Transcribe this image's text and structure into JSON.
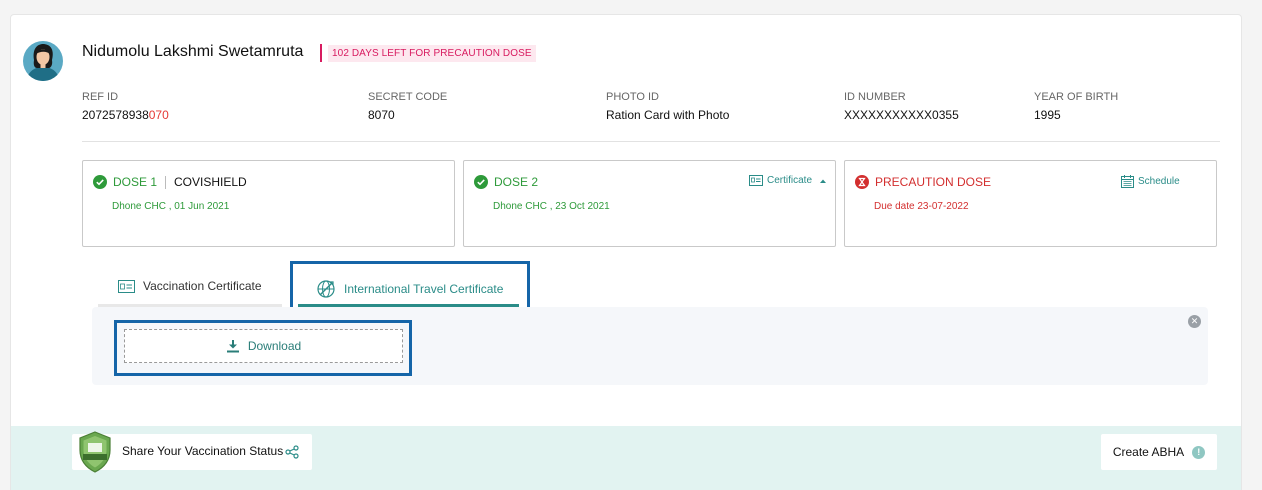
{
  "beneficiary": {
    "name": "Nidumolu Lakshmi Swetamruta",
    "days_left": "102 DAYS LEFT FOR PRECAUTION DOSE"
  },
  "info": {
    "ref_label": "REF ID",
    "ref_main": "2072578938",
    "ref_highlight": "070",
    "secret_label": "SECRET CODE",
    "secret_value": "8070",
    "photo_label": "PHOTO ID",
    "photo_value": "Ration Card with Photo",
    "idnum_label": "ID NUMBER",
    "idnum_value": "XXXXXXXXXXX0355",
    "yob_label": "YEAR OF BIRTH",
    "yob_value": "1995"
  },
  "doses": {
    "dose1": {
      "label": "DOSE 1",
      "vaccine": "COVISHIELD",
      "detail": "Dhone CHC , 01 Jun 2021"
    },
    "dose2": {
      "label": "DOSE 2",
      "detail": "Dhone CHC , 23 Oct 2021",
      "action": "Certificate"
    },
    "precaution": {
      "label": "PRECAUTION DOSE",
      "detail": "Due date 23-07-2022",
      "action": "Schedule"
    }
  },
  "tabs": {
    "vaccination": "Vaccination Certificate",
    "international": "International Travel Certificate"
  },
  "download_label": "Download",
  "footer": {
    "share_label": "Share Your Vaccination Status",
    "abha_label": "Create ABHA"
  },
  "colors": {
    "teal": "#2a8c88",
    "green": "#2e9a3a",
    "red": "#d32f2f",
    "pink": "#d81b60",
    "highlight_box": "#1565a8"
  },
  "icons": [
    "avatar-icon",
    "check-circle-icon",
    "certificate-icon",
    "caret-up-icon",
    "hourglass-icon",
    "calendar-icon",
    "vaccination-certificate-icon",
    "passport-globe-icon",
    "close-icon",
    "download-icon",
    "shield-badge-icon",
    "share-icon",
    "info-icon"
  ]
}
